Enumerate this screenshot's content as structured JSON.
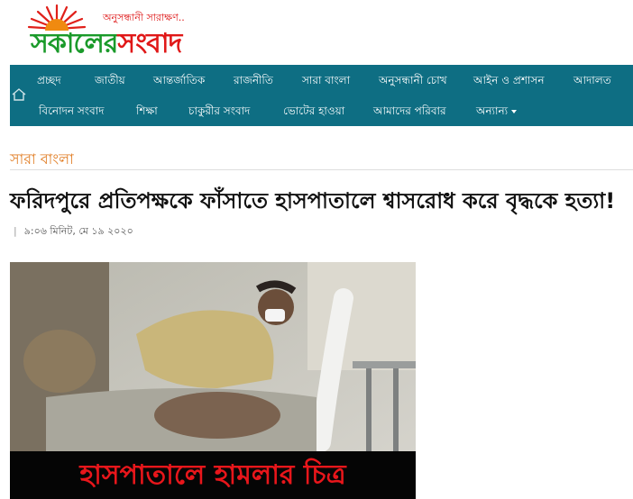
{
  "site": {
    "tagline": "অনুসন্ধানী সারাক্ষণ..",
    "name_part1": "সকালের",
    "name_part2": "সংবাদ",
    "colors": {
      "green": "#1a9a2a",
      "red": "#e01818",
      "nav": "#0e6e83",
      "category": "#e07a1f"
    }
  },
  "nav": {
    "home_icon": "home-icon",
    "row1": [
      "প্রচ্ছদ",
      "জাতীয়",
      "আন্তর্জাতিক",
      "রাজনীতি",
      "সারা বাংলা",
      "অনুসন্ধানী চোখ",
      "আইন ও প্রশাসন",
      "আদালত"
    ],
    "row2": [
      "বিনোদন সংবাদ",
      "শিক্ষা",
      "চাকুরীর সংবাদ",
      "ভোটের হাওয়া",
      "আমাদের পরিবার",
      "অন্যান্য"
    ]
  },
  "article": {
    "category": "সারা বাংলা",
    "headline": "ফরিদপুরে প্রতিপক্ষকে ফাঁসাতে হাসপাতালে শ্বাসরোধ করে বৃদ্ধকে হত্যা!",
    "meta_sep": "|",
    "timestamp": "৯:০৬ মিনিট, মে ১৯ ২০২০",
    "image_caption": "হাসপাতালে হামলার চিত্র"
  }
}
